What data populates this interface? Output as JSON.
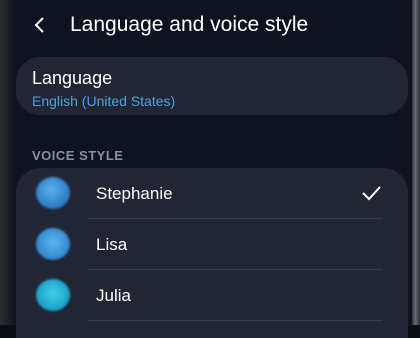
{
  "header": {
    "title": "Language and voice style"
  },
  "language": {
    "label": "Language",
    "value": "English (United States)"
  },
  "voice_section": {
    "label": "VOICE STYLE"
  },
  "voices": [
    {
      "name": "Stephanie",
      "selected": true,
      "avatar_color": "#3a8fd8"
    },
    {
      "name": "Lisa",
      "selected": false,
      "avatar_color": "#3f95de"
    },
    {
      "name": "Julia",
      "selected": false,
      "avatar_color": "#2ab3d6"
    }
  ],
  "colors": {
    "accent": "#4fa3e0",
    "background": "#0f1220",
    "card": "#222534"
  }
}
